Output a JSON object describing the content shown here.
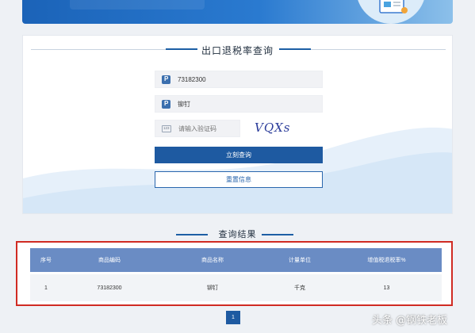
{
  "query_form": {
    "title": "出口退税率查询",
    "commodity_code_value": "73182300",
    "commodity_name_value": "铆钉",
    "captcha_placeholder": "请输入验证码",
    "captcha_text": "VQXs",
    "submit_label": "立刻查询",
    "reset_label": "重置信息"
  },
  "results": {
    "title": "查询结果",
    "columns": [
      "序号",
      "商品编码",
      "商品名称",
      "计量单位",
      "增值税退税率%"
    ],
    "rows": [
      [
        "1",
        "73182300",
        "铆钉",
        "千克",
        "13"
      ]
    ]
  },
  "pagination": {
    "current_page": "1"
  },
  "watermark": "头条 @钢铁老板",
  "colors": {
    "primary": "#1e5aa1",
    "table_header": "#6a8cc4",
    "highlight_border": "#d02b23"
  },
  "icons": [
    "p-field-icon",
    "captcha-code-icon",
    "document-check-icon"
  ]
}
